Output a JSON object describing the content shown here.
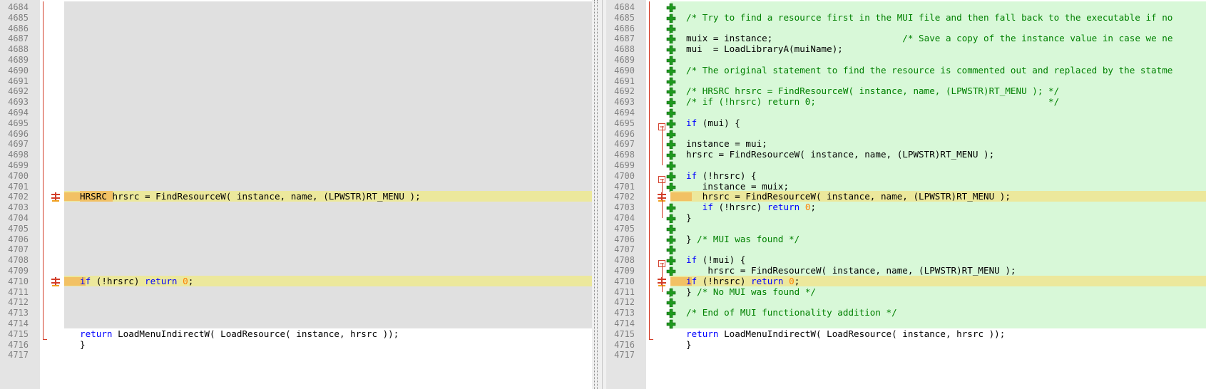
{
  "left": {
    "lines": [
      {
        "num": "4684",
        "kind": "removed",
        "text": ""
      },
      {
        "num": "4685",
        "kind": "removed",
        "text": ""
      },
      {
        "num": "4686",
        "kind": "removed",
        "text": ""
      },
      {
        "num": "4687",
        "kind": "removed",
        "text": ""
      },
      {
        "num": "4688",
        "kind": "removed",
        "text": ""
      },
      {
        "num": "4689",
        "kind": "removed",
        "text": ""
      },
      {
        "num": "4690",
        "kind": "removed",
        "text": ""
      },
      {
        "num": "4691",
        "kind": "removed",
        "text": ""
      },
      {
        "num": "4692",
        "kind": "removed",
        "text": ""
      },
      {
        "num": "4693",
        "kind": "removed",
        "text": ""
      },
      {
        "num": "4694",
        "kind": "removed",
        "text": ""
      },
      {
        "num": "4695",
        "kind": "removed",
        "text": ""
      },
      {
        "num": "4696",
        "kind": "removed",
        "text": ""
      },
      {
        "num": "4697",
        "kind": "removed",
        "text": ""
      },
      {
        "num": "4698",
        "kind": "removed",
        "text": ""
      },
      {
        "num": "4699",
        "kind": "removed",
        "text": ""
      },
      {
        "num": "4700",
        "kind": "removed",
        "text": ""
      },
      {
        "num": "4701",
        "kind": "removed",
        "text": ""
      },
      {
        "num": "4702",
        "kind": "changed",
        "text": "HRSRC hrsrc = FindResourceW( instance, name, (LPWSTR)RT_MENU );",
        "hl": "HRSRC "
      },
      {
        "num": "4703",
        "kind": "removed",
        "text": ""
      },
      {
        "num": "4704",
        "kind": "removed",
        "text": ""
      },
      {
        "num": "4705",
        "kind": "removed",
        "text": ""
      },
      {
        "num": "4706",
        "kind": "removed",
        "text": ""
      },
      {
        "num": "4707",
        "kind": "removed",
        "text": ""
      },
      {
        "num": "4708",
        "kind": "removed",
        "text": ""
      },
      {
        "num": "4709",
        "kind": "removed",
        "text": ""
      },
      {
        "num": "4710",
        "kind": "changed",
        "text": "if (!hrsrc) return 0;"
      },
      {
        "num": "4711",
        "kind": "removed",
        "text": ""
      },
      {
        "num": "4712",
        "kind": "removed",
        "text": ""
      },
      {
        "num": "4713",
        "kind": "removed",
        "text": ""
      },
      {
        "num": "4714",
        "kind": "removed",
        "text": ""
      },
      {
        "num": "4715",
        "kind": "normal",
        "text": "return LoadMenuIndirectW( LoadResource( instance, hrsrc ));"
      },
      {
        "num": "4716",
        "kind": "normal",
        "text": "}"
      },
      {
        "num": "4717",
        "kind": "normal",
        "text": ""
      }
    ]
  },
  "right": {
    "lines": [
      {
        "num": "4684",
        "kind": "added",
        "text": ""
      },
      {
        "num": "4685",
        "kind": "added",
        "text": "/* Try to find a resource first in the MUI file and then fall back to the executable if no"
      },
      {
        "num": "4686",
        "kind": "added",
        "text": ""
      },
      {
        "num": "4687",
        "kind": "added",
        "text": "muix = instance;                        /* Save a copy of the instance value in case we ne"
      },
      {
        "num": "4688",
        "kind": "added",
        "text": "mui  = LoadLibraryA(muiName);"
      },
      {
        "num": "4689",
        "kind": "added",
        "text": ""
      },
      {
        "num": "4690",
        "kind": "added",
        "text": "/* The original statement to find the resource is commented out and replaced by the statme"
      },
      {
        "num": "4691",
        "kind": "added",
        "text": ""
      },
      {
        "num": "4692",
        "kind": "added",
        "text": "/* HRSRC hrsrc = FindResourceW( instance, name, (LPWSTR)RT_MENU ); */"
      },
      {
        "num": "4693",
        "kind": "added",
        "text": "/* if (!hrsrc) return 0;                                           */"
      },
      {
        "num": "4694",
        "kind": "added",
        "text": ""
      },
      {
        "num": "4695",
        "kind": "added",
        "text": "if (mui) {",
        "fold": true
      },
      {
        "num": "4696",
        "kind": "added",
        "text": ""
      },
      {
        "num": "4697",
        "kind": "added",
        "text": "instance = mui;"
      },
      {
        "num": "4698",
        "kind": "added",
        "text": "hrsrc = FindResourceW( instance, name, (LPWSTR)RT_MENU );"
      },
      {
        "num": "4699",
        "kind": "added",
        "text": ""
      },
      {
        "num": "4700",
        "kind": "added",
        "text": "if (!hrsrc) {",
        "fold": true
      },
      {
        "num": "4701",
        "kind": "added",
        "text": "   instance = muix;"
      },
      {
        "num": "4702",
        "kind": "changed",
        "text": "   hrsrc = FindResourceW( instance, name, (LPWSTR)RT_MENU );"
      },
      {
        "num": "4703",
        "kind": "added",
        "text": "   if (!hrsrc) return 0;"
      },
      {
        "num": "4704",
        "kind": "added",
        "text": "}"
      },
      {
        "num": "4705",
        "kind": "added",
        "text": ""
      },
      {
        "num": "4706",
        "kind": "added",
        "text": "} /* MUI was found */"
      },
      {
        "num": "4707",
        "kind": "added",
        "text": ""
      },
      {
        "num": "4708",
        "kind": "added",
        "text": "if (!mui) {",
        "fold": true
      },
      {
        "num": "4709",
        "kind": "added",
        "text": "    hrsrc = FindResourceW( instance, name, (LPWSTR)RT_MENU );"
      },
      {
        "num": "4710",
        "kind": "changed",
        "text": "if (!hrsrc) return 0;"
      },
      {
        "num": "4711",
        "kind": "added",
        "text": "} /* No MUI was found */"
      },
      {
        "num": "4712",
        "kind": "added",
        "text": ""
      },
      {
        "num": "4713",
        "kind": "added",
        "text": "/* End of MUI functionality addition */"
      },
      {
        "num": "4714",
        "kind": "added",
        "text": ""
      },
      {
        "num": "4715",
        "kind": "normal",
        "text": "return LoadMenuIndirectW( LoadResource( instance, hrsrc ));"
      },
      {
        "num": "4716",
        "kind": "normal",
        "text": "}"
      },
      {
        "num": "4717",
        "kind": "normal",
        "text": ""
      }
    ]
  },
  "icons": {
    "change_marker": "change-marker-icon",
    "added_line": "plus-icon",
    "fold_block": "collapse-icon"
  },
  "colors": {
    "removed_bg": "#e0e0e0",
    "added_bg": "#d8f8d8",
    "changed_bg": "#ece89c",
    "changed_highlight": "#f2c164",
    "keyword": "#0000ff",
    "comment": "#008000",
    "number": "#ff8000",
    "margin_line": "#d23c28",
    "plus_green": "#1e9a1e"
  }
}
